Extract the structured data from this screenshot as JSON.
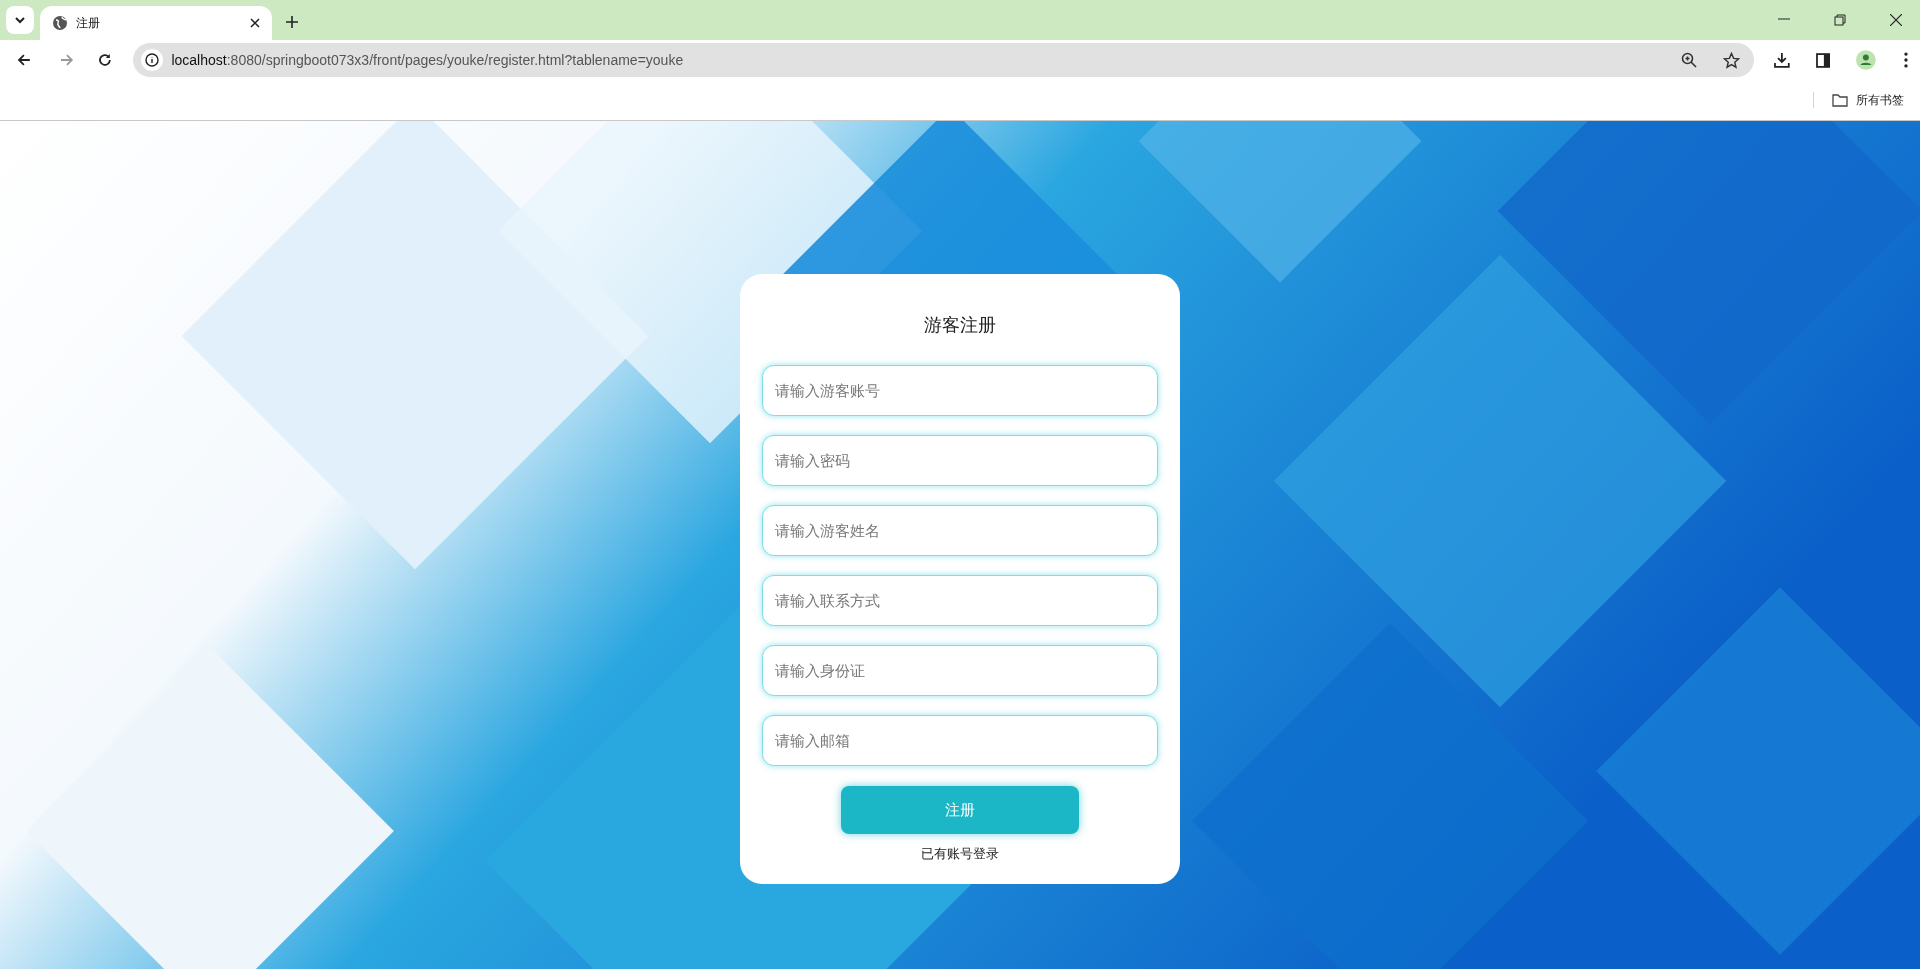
{
  "browser": {
    "tab": {
      "title": "注册"
    },
    "url": {
      "host": "localhost",
      "rest": ":8080/springboot073x3/front/pages/youke/register.html?tablename=youke"
    },
    "bookmarks_folder": "所有书签"
  },
  "form": {
    "title": "游客注册",
    "fields": [
      {
        "placeholder": "请输入游客账号"
      },
      {
        "placeholder": "请输入密码"
      },
      {
        "placeholder": "请输入游客姓名"
      },
      {
        "placeholder": "请输入联系方式"
      },
      {
        "placeholder": "请输入身份证"
      },
      {
        "placeholder": "请输入邮箱"
      }
    ],
    "submit": "注册",
    "login_link": "已有账号登录"
  }
}
